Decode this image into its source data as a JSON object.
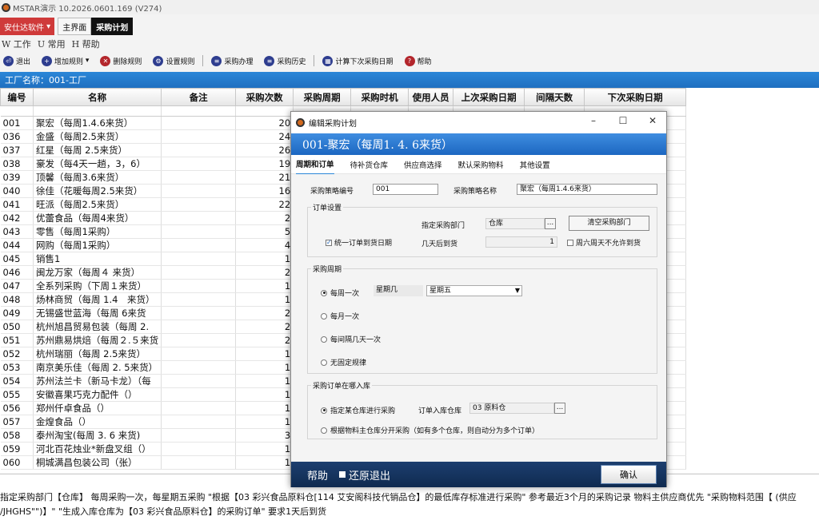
{
  "window": {
    "title": "MSTAR演示  10.2026.0601.169 (V274)"
  },
  "tabs": {
    "brand": "安仕达软件",
    "main": "主界面",
    "active": "采购计划"
  },
  "menu": [
    "W 工作",
    "U 常用",
    "H 帮助"
  ],
  "toolbar": [
    "退出",
    "增加规则",
    "删除规则",
    "设置规则",
    "采购办理",
    "采购历史",
    "计算下次采购日期",
    "帮助"
  ],
  "factory": "工厂名称：001-工厂",
  "grid": {
    "headers": [
      "编号",
      "名称",
      "备注",
      "采购次数",
      "采购周期",
      "采购时机",
      "使用人员",
      "上次采购日期",
      "间隔天数",
      "下次采购日期"
    ],
    "rows": [
      [
        "001",
        "聚宏（每周1.4.6来货）",
        "20"
      ],
      [
        "036",
        "金盛（每周2.5来货）",
        "24"
      ],
      [
        "037",
        "红星（每周 2.5来货）",
        "26"
      ],
      [
        "038",
        "豪发（每4天一趟，3，6）",
        "19"
      ],
      [
        "039",
        "顶馨（每周3.6来货）",
        "21"
      ],
      [
        "040",
        "徐佳（花暖每周2.5来货）",
        "16"
      ],
      [
        "041",
        "旺派（每周2.5来货）",
        "22"
      ],
      [
        "042",
        "优蕾食品（每周4来货）",
        "2"
      ],
      [
        "043",
        "零售（每周1采购）",
        "5"
      ],
      [
        "044",
        "网购（每周1采购）",
        "4"
      ],
      [
        "045",
        "销售1",
        "1"
      ],
      [
        "046",
        "闽龙万家（每周４ 来货）",
        "2"
      ],
      [
        "047",
        "全系列采购（下周１来货）",
        "1"
      ],
      [
        "048",
        "炀林商贸（每周 1.4　来货）",
        "1"
      ],
      [
        "049",
        "无锡盛世蓝海（每周 6来货",
        "2"
      ],
      [
        "050",
        "杭州旭昌贸易包装（每周 2.",
        "2"
      ],
      [
        "051",
        "苏州鼎易烘焙（每周２.５来货",
        "2"
      ],
      [
        "052",
        "杭州瑞丽（每周 2.5来货）",
        "1"
      ],
      [
        "053",
        "南京美乐佳（每周 2. 5来货）",
        "1"
      ],
      [
        "054",
        "苏州法兰卡（新马卡龙）（每",
        "1"
      ],
      [
        "055",
        "安徽喜果巧克力配件（）",
        "1"
      ],
      [
        "056",
        "郑州仟卓食品（）",
        "1"
      ],
      [
        "057",
        "金煌食品（）",
        "1"
      ],
      [
        "058",
        "泰州淘宝(每周 3. 6 来货)",
        "3"
      ],
      [
        "059",
        "河北百花烛业*新盘叉组（）",
        "1"
      ],
      [
        "060",
        "桐城满昌包装公司（张）",
        "1"
      ]
    ]
  },
  "status": {
    "line1": "指定采购部门【仓库】 每周采购一次，每星期五采购 \"根据【03  彩兴食品原料仓[114  艾安阁科技代销品仓】的最低库存标准进行采购\" 参考最近3个月的采购记录 物料主供应商优先 \"采购物料范围【 (供应",
    "line2": "/JHGHS\"\")】\" \"生成入库仓库为【03 彩兴食品原料仓】的采购订单\" 要求1天后到货"
  },
  "dialog": {
    "title": "编辑采购计划",
    "header": "001-聚宏（每周1. 4. 6来货）",
    "tabs": [
      "周期和订单",
      "待补货仓库",
      "供应商选择",
      "默认采购物料",
      "其他设置"
    ],
    "code_label": "采购策略编号",
    "code_value": "001",
    "name_label": "采购策略名称",
    "name_value": "聚宏（每周1.4.6来货）",
    "order_group": "订单设置",
    "dept_label": "指定采购部门",
    "dept_value": "仓库",
    "dept_browse": "...",
    "clear_dept": "清空采购部门",
    "unify_label": "统一订单到货日期",
    "unify_checked": "✓",
    "days_label": "几天后到货",
    "days_value": "1",
    "weekend_label": "周六周天不允许到货",
    "cycle_group": "采购周期",
    "cycle_weekly": "每周一次",
    "weekday_label": "星期几",
    "weekday_value": "星期五",
    "dropdown": "▼",
    "cycle_monthly": "每月一次",
    "cycle_interval": "每间隔几天一次",
    "cycle_none": "无固定规律",
    "wh_group": "采购订单在哪入库",
    "wh_specified": "指定某仓库进行采购",
    "wh_label": "订单入库仓库",
    "wh_value": "03 原料仓",
    "wh_browse": "...",
    "wh_auto": "根据物料主仓库分开采购（如有多个仓库，则自动分为多个订单）",
    "help": "帮助",
    "restore": "还原退出",
    "ok": "确认"
  }
}
